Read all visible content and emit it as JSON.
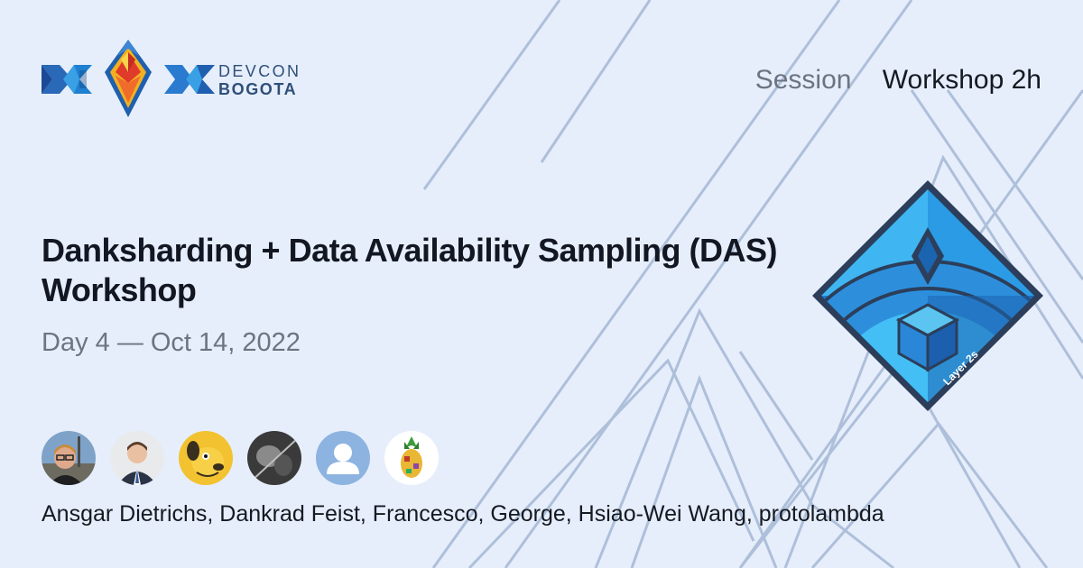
{
  "brand": {
    "logo_line1": "DEVCON",
    "logo_line2": "BOGOTA",
    "icon": "devcon-logo-icon"
  },
  "session": {
    "label": "Session",
    "type": "Workshop 2h"
  },
  "title": "Danksharding + Data Availability Sampling (DAS) Workshop",
  "date": "Day 4 — Oct 14, 2022",
  "track": {
    "label": "Layer 2s",
    "icon": "layer-2s-badge-icon"
  },
  "speakers": {
    "avatars": [
      {
        "name": "Ansgar Dietrichs",
        "icon": "avatar-photo"
      },
      {
        "name": "Dankrad Feist",
        "icon": "avatar-photo"
      },
      {
        "name": "Francesco",
        "icon": "avatar-dog-cartoon"
      },
      {
        "name": "George",
        "icon": "avatar-photo-dark"
      },
      {
        "name": "Hsiao-Wei Wang",
        "icon": "default-user-icon"
      },
      {
        "name": "protolambda",
        "icon": "avatar-pineapple"
      }
    ],
    "names_text": "Ansgar Dietrichs, Dankrad Feist, Francesco, George, Hsiao-Wei Wang, protolambda"
  },
  "colors": {
    "background": "#e6eefb",
    "pattern_lines": "#a9bdd9",
    "title": "#121722",
    "muted": "#6c7482",
    "brand_text": "#2f4f78",
    "badge_blue": "#2f8fd8"
  }
}
